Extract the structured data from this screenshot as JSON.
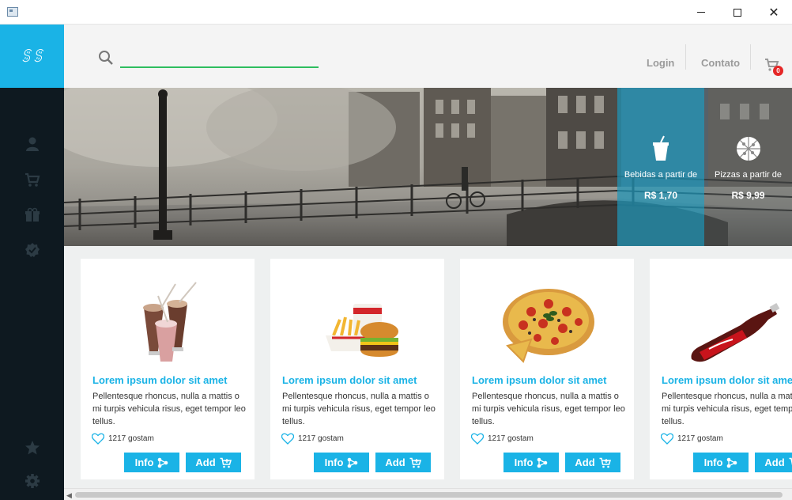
{
  "window": {
    "close_glyph": "✕"
  },
  "brand": {
    "logo_text": "ꌚꌚ"
  },
  "sidebar": {
    "items": [
      {
        "icon": "user-icon"
      },
      {
        "icon": "cart-icon"
      },
      {
        "icon": "gift-icon"
      },
      {
        "icon": "verified-badge-icon"
      },
      {
        "icon": "star-icon"
      },
      {
        "icon": "gear-icon"
      }
    ]
  },
  "header": {
    "search_value": "",
    "nav": {
      "login": "Login",
      "contato": "Contato"
    },
    "cart_count": "0"
  },
  "promos": [
    {
      "label": "Bebidas a partir de",
      "price": "R$ 1,70",
      "icon": "drink-cup-icon"
    },
    {
      "label": "Pizzas a partir de",
      "price": "R$ 9,99",
      "icon": "pizza-icon"
    }
  ],
  "products": [
    {
      "image": "milkshake-image",
      "title": "Lorem ipsum dolor sit amet",
      "description": "Pellentesque rhoncus, nulla a mattis o mi turpis vehicula risus, eget tempor leo tellus.",
      "likes": "1217 gostam",
      "info_label": "Info",
      "add_label": "Add"
    },
    {
      "image": "burger-fries-image",
      "title": "Lorem ipsum dolor sit amet",
      "description": "Pellentesque rhoncus, nulla a mattis o mi turpis vehicula risus, eget tempor leo tellus.",
      "likes": "1217 gostam",
      "info_label": "Info",
      "add_label": "Add"
    },
    {
      "image": "pizza-image",
      "title": "Lorem ipsum dolor sit amet",
      "description": "Pellentesque rhoncus, nulla a mattis o mi turpis vehicula risus, eget tempor leo tellus.",
      "likes": "1217 gostam",
      "info_label": "Info",
      "add_label": "Add"
    },
    {
      "image": "soda-bottle-image",
      "title": "Lorem ipsum dolor sit amet",
      "description": "Pellentesque rhoncus, nulla a mattis o mi turpis vehicula risus, eget tempor leo tellus.",
      "likes": "1217 gostam",
      "info_label": "Info",
      "add_label": "Add"
    }
  ],
  "colors": {
    "accent": "#1ab3e6",
    "sidebar": "#0e1920",
    "search_underline": "#2ebd5e",
    "badge": "#e52727"
  }
}
